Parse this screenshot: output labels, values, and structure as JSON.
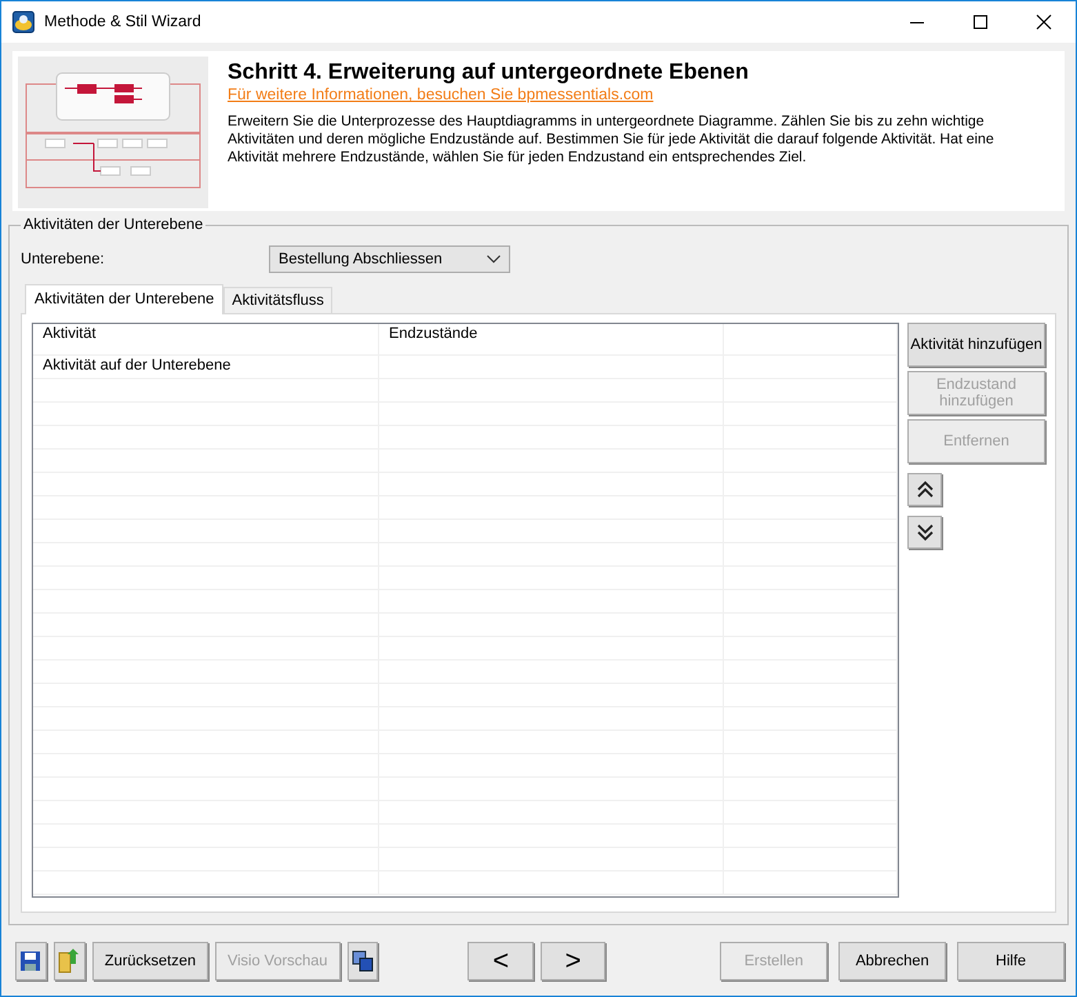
{
  "window": {
    "title": "Methode & Stil Wizard"
  },
  "header": {
    "title": "Schritt 4. Erweiterung auf untergeordnete Ebenen",
    "link": "Für weitere Informationen, besuchen Sie bpmessentials.com",
    "description": "Erweitern Sie die Unterprozesse des Hauptdiagramms in untergeordnete Diagramme. Zählen Sie bis zu zehn wichtige Aktivitäten und deren mögliche Endzustände auf. Bestimmen Sie für jede Aktivität die darauf folgende Aktivität. Hat eine Aktivität mehrere Endzustände, wählen Sie für jeden Endzustand ein entsprechendes Ziel."
  },
  "group": {
    "title": "Aktivitäten der Unterebene",
    "sublevel_label": "Unterebene:",
    "sublevel_value": "Bestellung Abschliessen"
  },
  "tabs": [
    {
      "label": "Aktivitäten der Unterebene",
      "selected": true
    },
    {
      "label": "Aktivitätsfluss",
      "selected": false
    }
  ],
  "table": {
    "columns": [
      "Aktivität",
      "Endzustände"
    ],
    "rows": [
      [
        "Aktivität auf der Unterebene",
        ""
      ]
    ]
  },
  "side_buttons": [
    {
      "label": "Aktivität hinzufügen",
      "disabled": false
    },
    {
      "label": "Endzustand hinzufügen",
      "disabled": true
    },
    {
      "label": "Entfernen",
      "disabled": true
    }
  ],
  "footer": {
    "reset": {
      "label": "Zurücksetzen",
      "disabled": false
    },
    "preview": {
      "label": "Visio Vorschau",
      "disabled": true
    },
    "back": "<",
    "next": ">",
    "actions": [
      {
        "label": "Erstellen",
        "disabled": true
      },
      {
        "label": "Abbrechen",
        "disabled": false
      },
      {
        "label": "Hilfe",
        "disabled": false
      }
    ]
  }
}
